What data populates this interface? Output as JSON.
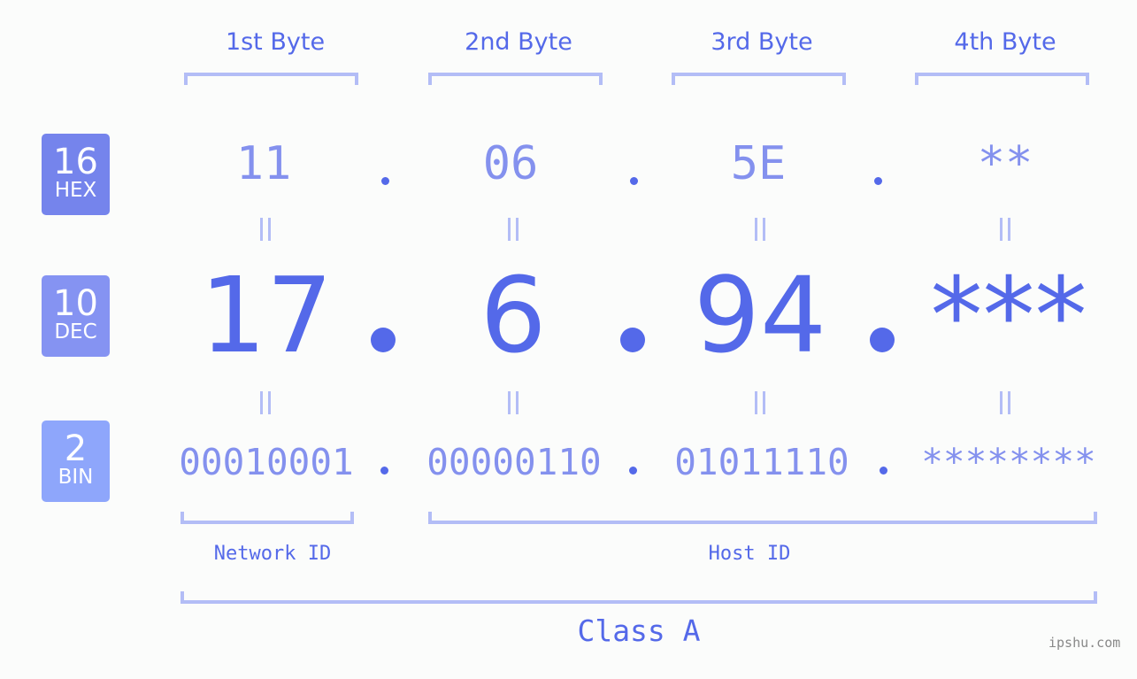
{
  "headers": [
    "1st Byte",
    "2nd Byte",
    "3rd Byte",
    "4th Byte"
  ],
  "rows": {
    "hex": {
      "base": "16",
      "label": "HEX",
      "values": [
        "11",
        "06",
        "5E",
        "**"
      ],
      "color": "#7584ec"
    },
    "dec": {
      "base": "10",
      "label": "DEC",
      "values": [
        "17",
        "6",
        "94",
        "***"
      ],
      "color": "#8593f2"
    },
    "bin": {
      "base": "2",
      "label": "BIN",
      "values": [
        "00010001",
        "00000110",
        "01011110",
        "********"
      ],
      "color": "#8ea6fb"
    }
  },
  "equals_symbol": "=",
  "network_id_label": "Network ID",
  "host_id_label": "Host ID",
  "class_label": "Class A",
  "footer": "ipshu.com",
  "colors": {
    "accent": "#5469e9",
    "light": "#8491ee",
    "bracket": "#b3bdf6"
  }
}
